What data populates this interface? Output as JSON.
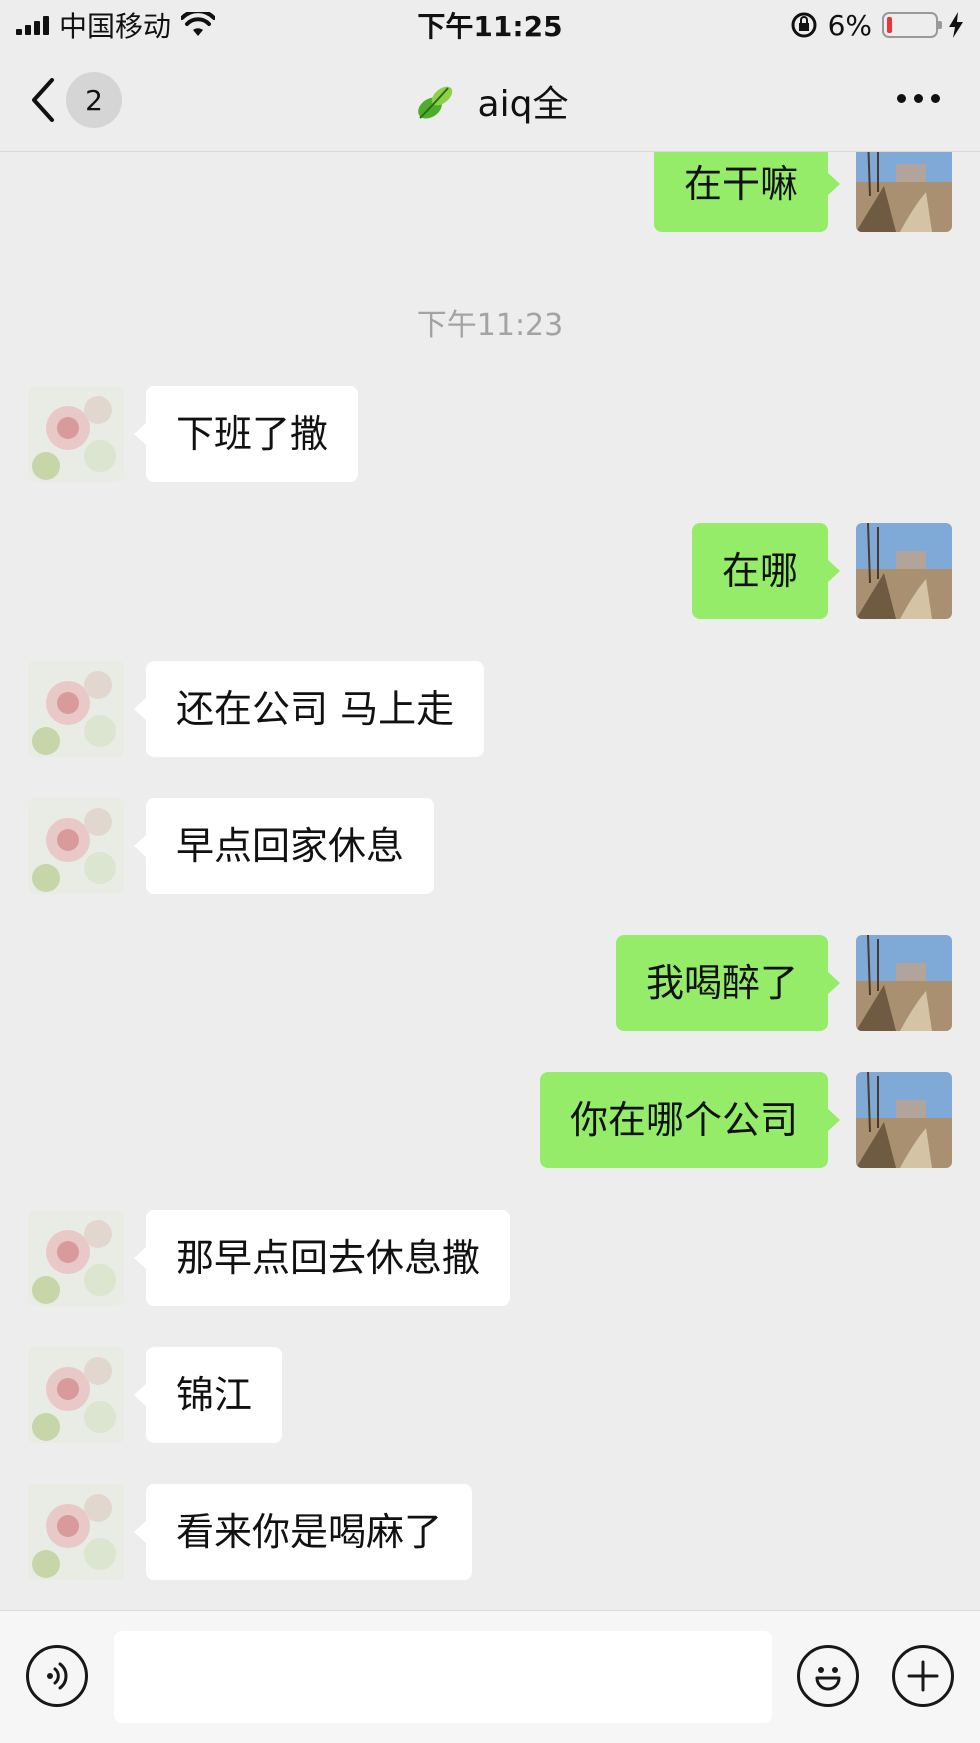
{
  "status_bar": {
    "carrier": "中国移动",
    "time": "下午11:25",
    "battery": "6%"
  },
  "nav": {
    "unread_count": "2",
    "title": "aiq全"
  },
  "chat": {
    "timestamp": "下午11:23",
    "messages": [
      {
        "side": "right",
        "text": "在干嘛"
      },
      {
        "side": "left",
        "text": "下班了撒"
      },
      {
        "side": "right",
        "text": "在哪"
      },
      {
        "side": "left",
        "text": "还在公司 马上走"
      },
      {
        "side": "left",
        "text": "早点回家休息"
      },
      {
        "side": "right",
        "text": "我喝醉了"
      },
      {
        "side": "right",
        "text": "你在哪个公司"
      },
      {
        "side": "left",
        "text": "那早点回去休息撒"
      },
      {
        "side": "left",
        "text": "锦江"
      },
      {
        "side": "left",
        "text": "看来你是喝麻了"
      }
    ]
  },
  "input_bar": {
    "message_value": "",
    "icons": [
      "voice-icon",
      "emoji-icon",
      "plus-icon"
    ]
  },
  "colors": {
    "background": "#ededed",
    "sent_bubble": "#95ec69",
    "received_bubble": "#ffffff",
    "battery_low": "#e33333"
  }
}
